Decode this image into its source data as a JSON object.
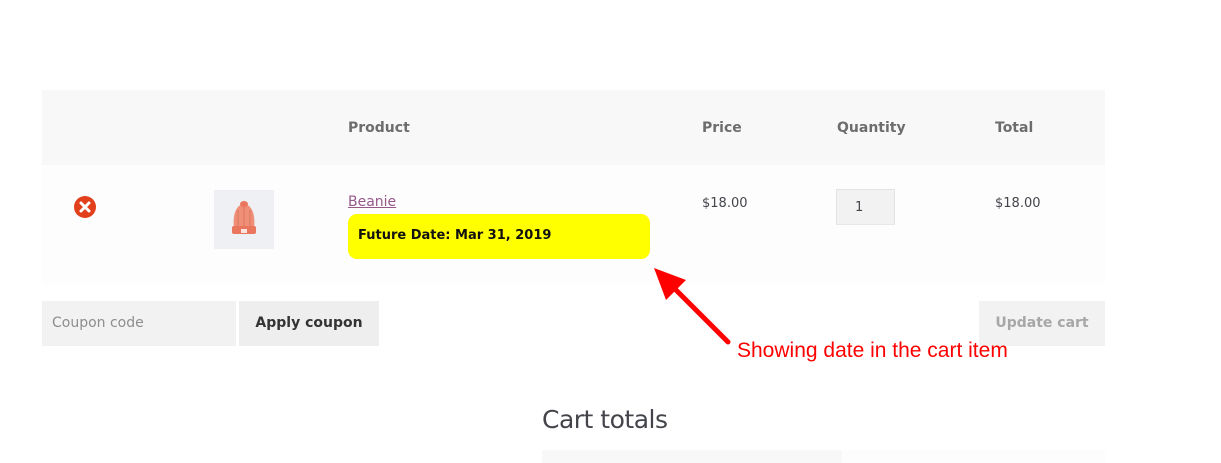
{
  "cart": {
    "headers": {
      "product": "Product",
      "price": "Price",
      "quantity": "Quantity",
      "total": "Total"
    },
    "items": [
      {
        "name": "Beanie",
        "meta": "Future Date: Mar 31, 2019",
        "price": "$18.00",
        "quantity": "1",
        "total": "$18.00",
        "thumbnail_icon": "beanie-hat-icon"
      }
    ]
  },
  "actions": {
    "coupon_placeholder": "Coupon code",
    "apply_coupon_label": "Apply coupon",
    "update_cart_label": "Update cart"
  },
  "annotation": {
    "text": "Showing date in the cart item",
    "color": "#ff0000"
  },
  "totals": {
    "title": "Cart totals"
  },
  "colors": {
    "link": "#96588a",
    "remove": "#e2401c",
    "highlight": "#ffff00"
  }
}
